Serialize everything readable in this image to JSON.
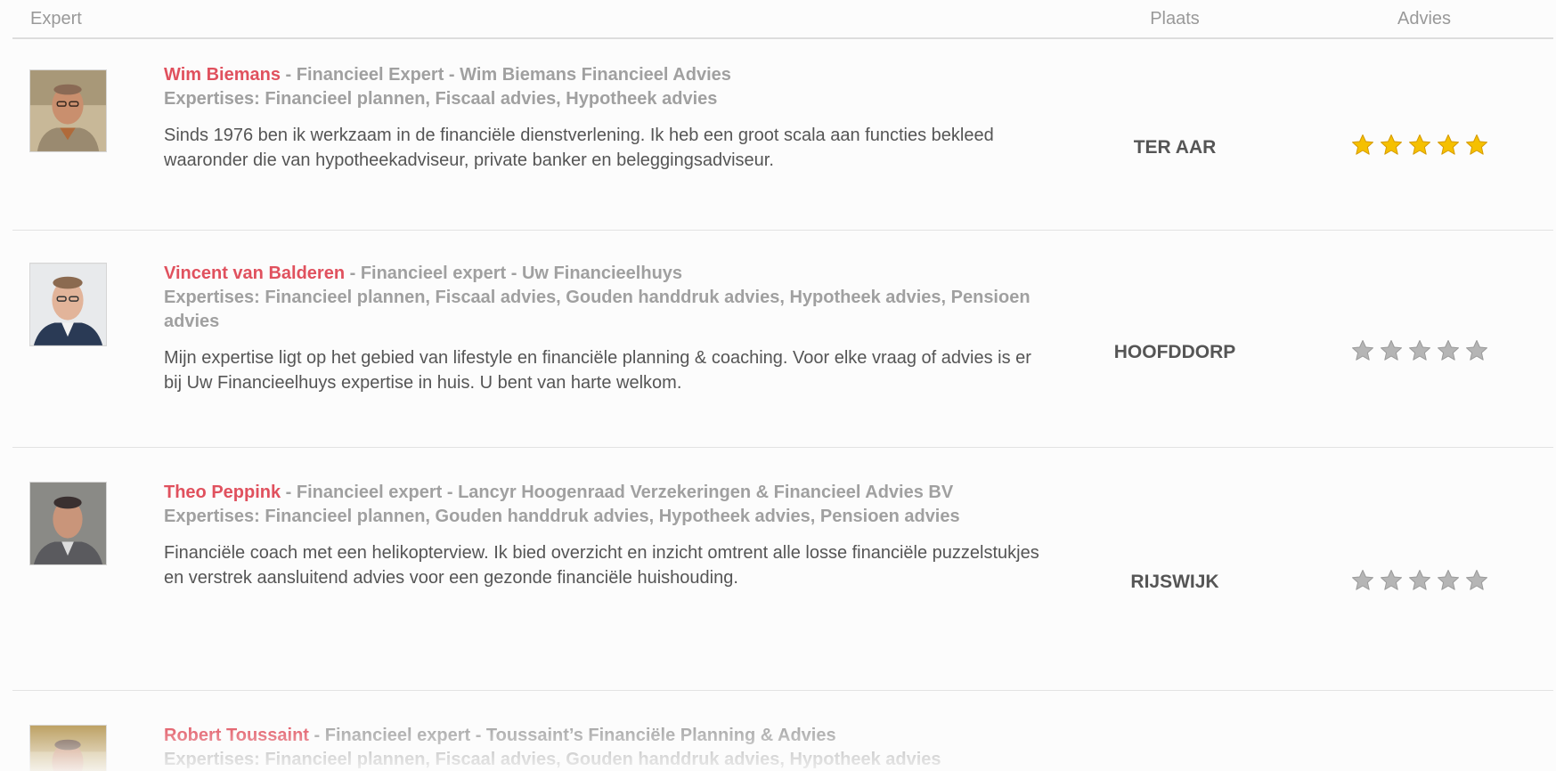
{
  "header": {
    "expert_label": "Expert",
    "plaats_label": "Plaats",
    "advies_label": "Advies"
  },
  "experts": [
    {
      "name": "Wim Biemans",
      "function": " - Financieel Expert - Wim Biemans Financieel Advies",
      "expertises": "Expertises: Financieel plannen, Fiscaal advies, Hypotheek advies",
      "description": "Sinds 1976 ben ik werkzaam in de financiële dienstverlening. Ik heb een groot scala aan functies bekleed waaronder die van hypotheekadviseur, private banker en beleggingsadviseur.",
      "plaats": "TER AAR",
      "rating": 5
    },
    {
      "name": "Vincent van Balderen",
      "function": " - Financieel expert - Uw Financieelhuys",
      "expertises": "Expertises: Financieel plannen, Fiscaal advies, Gouden handdruk advies, Hypotheek advies, Pensioen advies",
      "description": "Mijn expertise ligt op het gebied van lifestyle en financiële planning & coaching. Voor elke vraag of advies is er bij Uw Financieelhuys expertise in huis. U bent van harte welkom.",
      "plaats": "HOOFDDORP",
      "rating": 0
    },
    {
      "name": "Theo Peppink",
      "function": " - Financieel expert - Lancyr Hoogenraad Verzekeringen & Financieel Advies BV",
      "expertises": "Expertises: Financieel plannen, Gouden handdruk advies, Hypotheek advies, Pensioen advies",
      "description": "Financiële coach met een helikopterview. Ik bied overzicht en inzicht omtrent alle losse financiële puzzelstukjes en verstrek aansluitend advies voor een gezonde financiële huishouding.",
      "plaats": "RIJSWIJK",
      "rating": 0
    },
    {
      "name": "Robert Toussaint",
      "function": " - Financieel expert - Toussaint’s Financiële Planning & Advies",
      "expertises": "Expertises: Financieel plannen, Fiscaal advies, Gouden handdruk advies, Hypotheek advies"
    }
  ],
  "colors": {
    "name": "#e0515e",
    "star_gold": "#f5c000",
    "star_grey": "#b5b5b5"
  }
}
